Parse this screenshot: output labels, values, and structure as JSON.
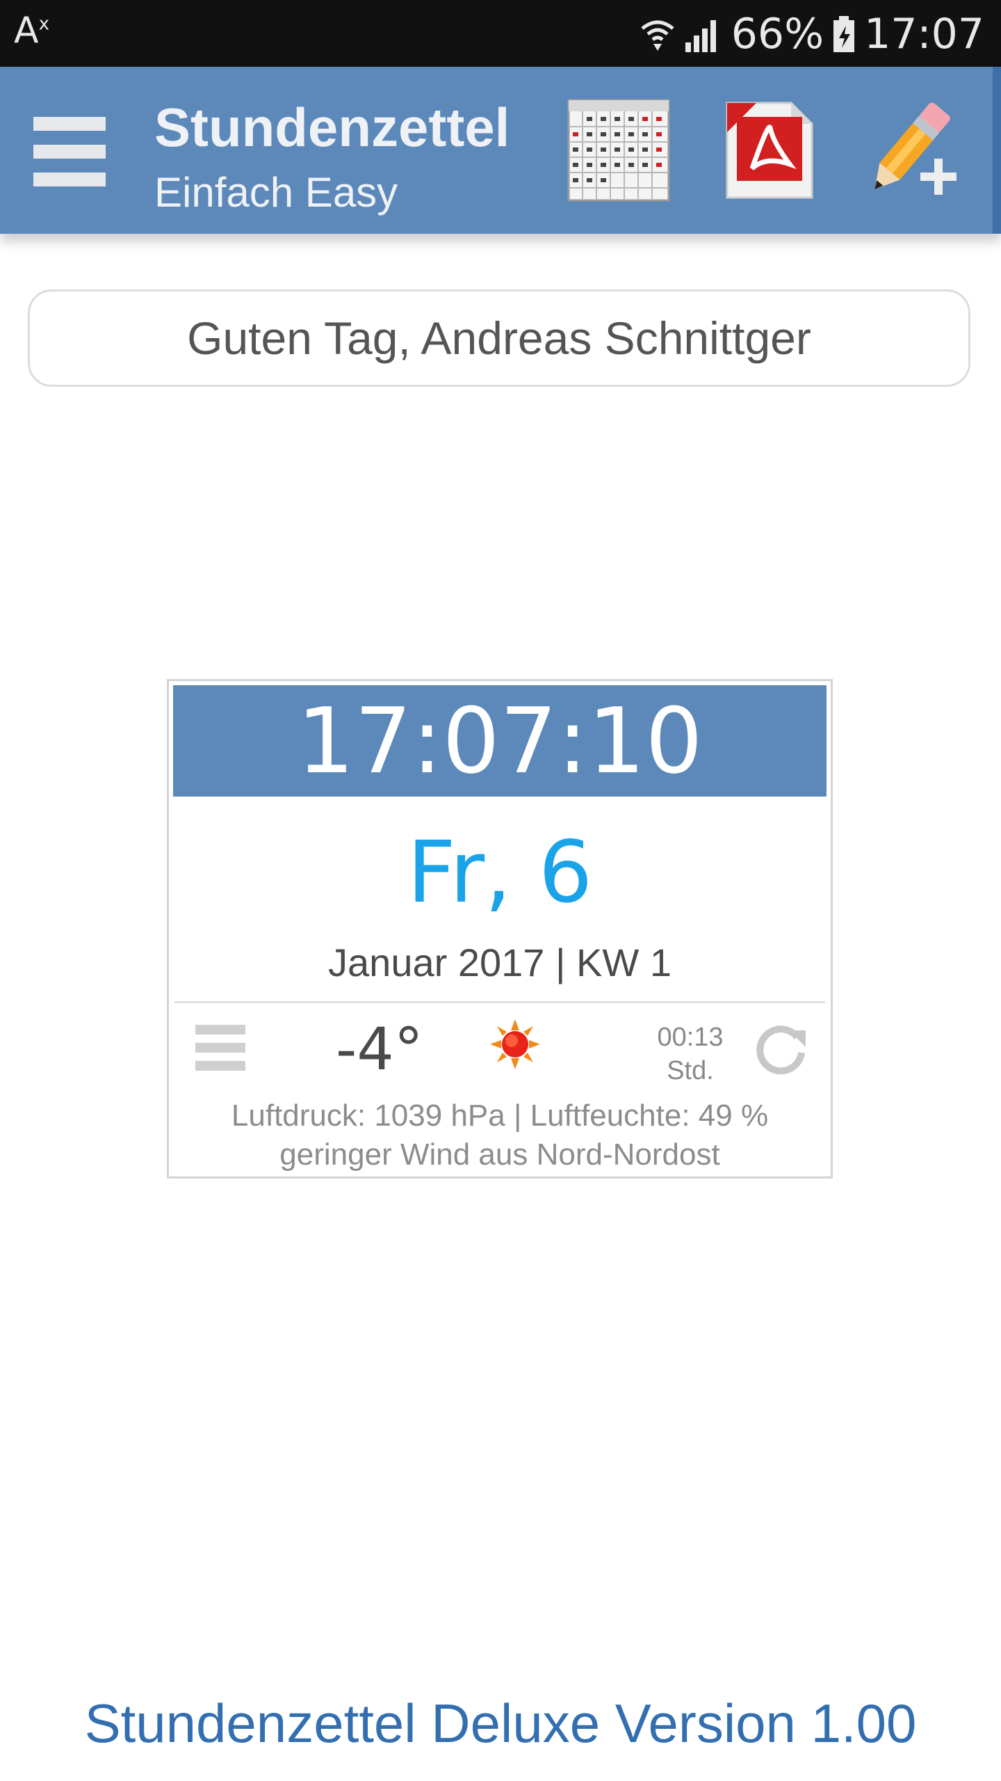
{
  "status_bar": {
    "left_text": "A",
    "left_sup": "x",
    "battery": "66%",
    "time": "17:07"
  },
  "app_bar": {
    "title": "Stundenzettel",
    "subtitle": "Einfach Easy",
    "accent_color": "#5c89ba",
    "icons": [
      "menu-icon",
      "calendar-icon",
      "pdf-icon",
      "pencil-add-icon"
    ]
  },
  "greeting": {
    "text": "Guten Tag, Andreas Schnittger"
  },
  "widget": {
    "clock": "17:07:10",
    "day": "Fr, 6",
    "month_week": "Januar 2017 | KW 1",
    "temperature": "-4°",
    "weather_icon": "sun-icon",
    "sun_time": "00:13",
    "sun_unit": "Std.",
    "pressure_humidity": "Luftdruck: 1039 hPa | Luftfeuchte: 49 %",
    "wind": "geringer Wind aus Nord-Nordost"
  },
  "footer": {
    "version": "Stundenzettel Deluxe Version 1.00"
  }
}
